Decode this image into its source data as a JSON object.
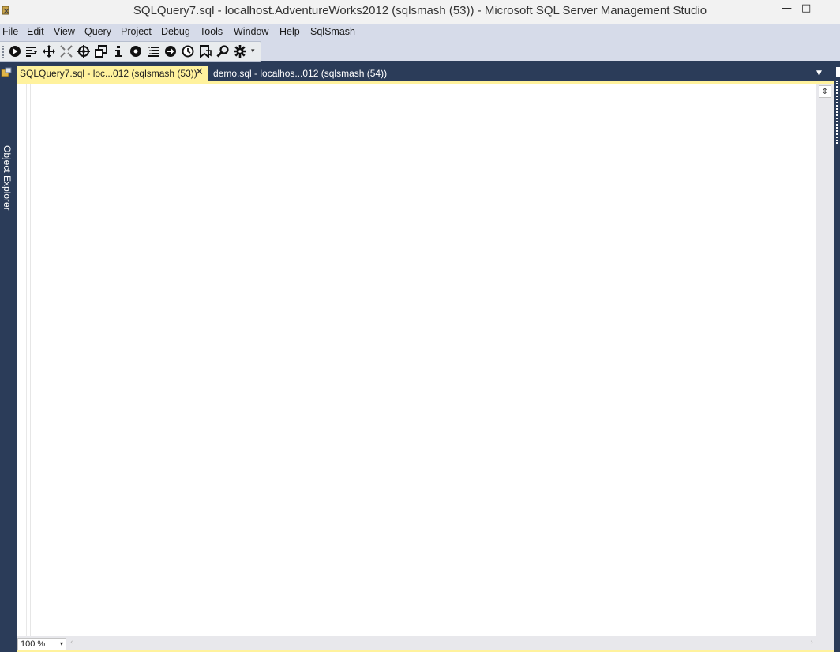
{
  "window": {
    "title": "SQLQuery7.sql - localhost.AdventureWorks2012 (sqlsmash (53)) - Microsoft SQL Server Management Studio",
    "minimize_glyph": "—",
    "maximize_glyph": "□"
  },
  "menu": [
    "File",
    "Edit",
    "View",
    "Query",
    "Project",
    "Debug",
    "Tools",
    "Window",
    "Help",
    "SqlSmash"
  ],
  "toolbar": {
    "icons": [
      "play-icon",
      "format-lines-icon",
      "move-icon",
      "collapse-icon",
      "target-icon",
      "windows-icon",
      "info-icon",
      "record-icon",
      "list-icon",
      "arrow-right-circle-icon",
      "clock-icon",
      "bookmark-icon",
      "search-icon",
      "gear-icon"
    ],
    "overflow_glyph": "▾"
  },
  "tabs": [
    {
      "label": "SQLQuery7.sql - loc...012 (sqlsmash (53))",
      "active": true,
      "close_glyph": "✕"
    },
    {
      "label": "demo.sql - localhos...012 (sqlsmash (54))",
      "active": false
    }
  ],
  "tab_dropdown_glyph": "▼",
  "side_panel": {
    "left_label": "Object Explorer"
  },
  "editor": {
    "zoom": "100 %",
    "zoom_arrow": "▾",
    "split_glyph": "⇕",
    "scroll_left_glyph": "‹",
    "scroll_right_glyph": "›"
  },
  "colors": {
    "frame": "#2b3c59",
    "menu_bg": "#d6dbe9",
    "active_tab": "#fff29d",
    "editor_bg": "#ffffff"
  }
}
